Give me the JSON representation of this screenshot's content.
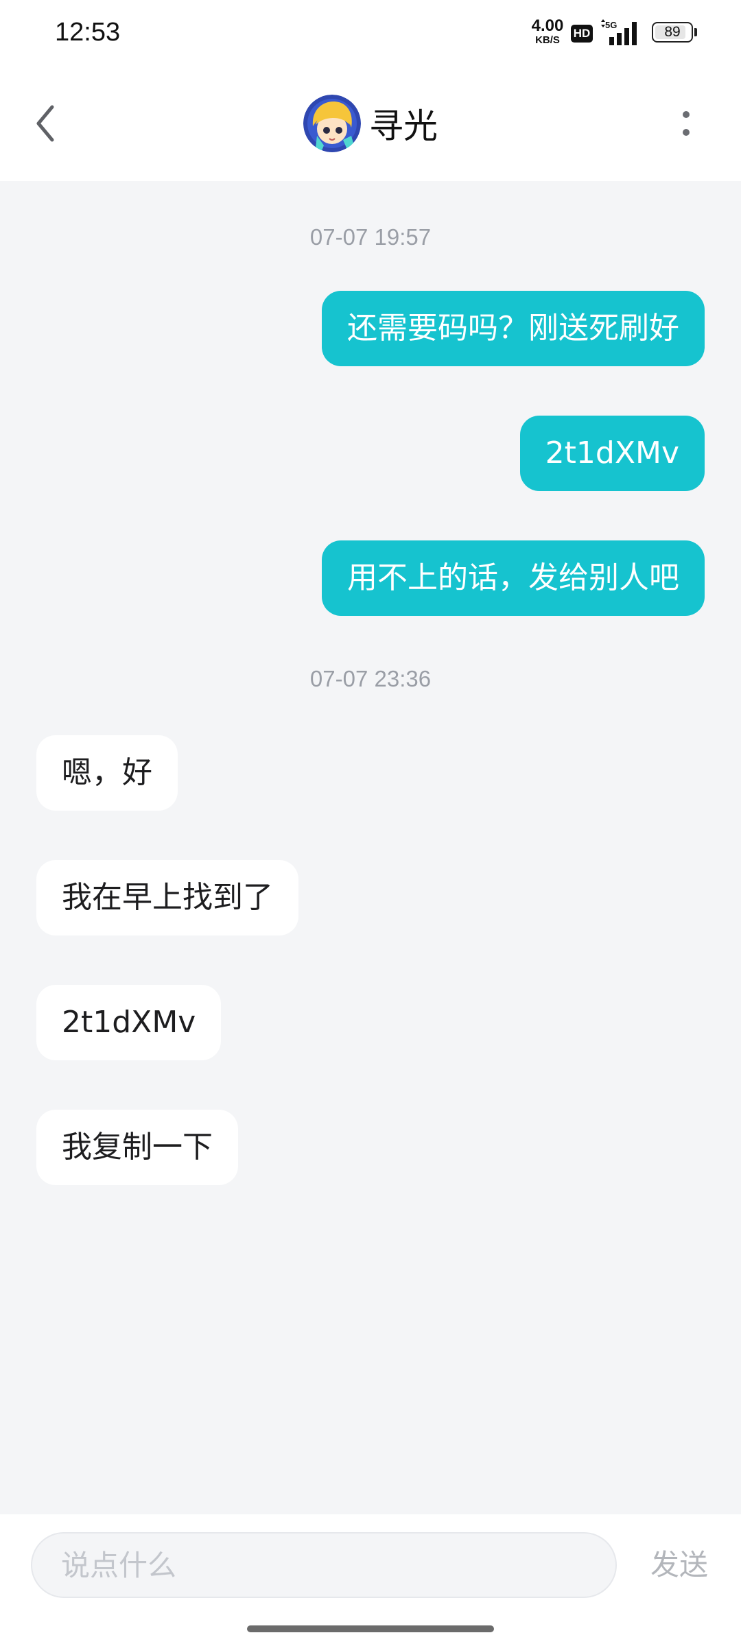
{
  "status_bar": {
    "time": "12:53",
    "net_speed_value": "4.00",
    "net_speed_unit": "KB/S",
    "hd_label": "HD",
    "network_label": "5G",
    "battery_level": "89",
    "battery_fraction": 0.89
  },
  "header": {
    "title": "寻光",
    "back_icon": "chevron-left-icon",
    "more_icon": "more-vertical-icon"
  },
  "messages": {
    "group1_time": "07-07 19:57",
    "sent1": "还需要码吗？刚送死刷好",
    "sent2": "2t1dXMv",
    "sent3": "用不上的话，发给别人吧",
    "group2_time": "07-07 23:36",
    "recv1": "嗯，好",
    "recv2": "我在早上找到了",
    "recv3": "2t1dXMv",
    "recv4": "我复制一下"
  },
  "composer": {
    "placeholder": "说点什么",
    "value": "",
    "send_label": "发送"
  },
  "colors": {
    "sent_bubble": "#16c3cf",
    "received_bubble": "#ffffff",
    "chat_background": "#f4f5f7",
    "timestamp_text": "#9a9ea6"
  }
}
